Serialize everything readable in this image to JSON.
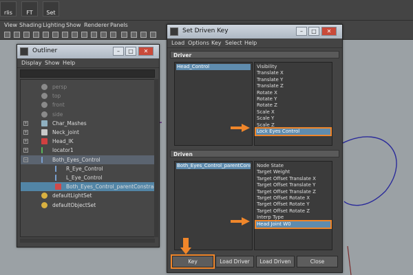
{
  "shelf": {
    "buttons": [
      {
        "label": "rlis",
        "icon": "rivet-shelf-icon"
      },
      {
        "label": "FT",
        "icon": "ft-shelf-icon"
      },
      {
        "label": "Set",
        "icon": "set-shelf-icon"
      }
    ]
  },
  "panel_menu": [
    "View",
    "Shading",
    "Lighting",
    "Show",
    "Renderer",
    "Panels"
  ],
  "outliner": {
    "title": "Outliner",
    "menus": [
      "Display",
      "Show",
      "Help"
    ],
    "items": [
      {
        "label": "persp",
        "icon": "camera-icon",
        "dim": true
      },
      {
        "label": "top",
        "icon": "camera-icon",
        "dim": true
      },
      {
        "label": "front",
        "icon": "camera-icon",
        "dim": true
      },
      {
        "label": "side",
        "icon": "camera-icon",
        "dim": true
      },
      {
        "label": "Char_Mashes",
        "icon": "mesh-icon",
        "expand": true
      },
      {
        "label": "Neck_joint",
        "icon": "joint-icon",
        "expand": true
      },
      {
        "label": "Head_IK",
        "icon": "ik-handle-icon",
        "expand": true
      },
      {
        "label": "locator1",
        "icon": "locator-icon",
        "expand": true
      },
      {
        "label": "Both_Eyes_Control",
        "icon": "curve-icon",
        "expand": true,
        "expanded": true,
        "highlight": true
      },
      {
        "label": "R_Eye_Control",
        "icon": "curve-icon",
        "child": true
      },
      {
        "label": "L_Eye_Control",
        "icon": "curve-icon",
        "child": true
      },
      {
        "label": "Both_Eyes_Control_parentConstraint1",
        "icon": "constraint-icon",
        "child": true,
        "selected": true
      },
      {
        "label": "defaultLightSet",
        "icon": "set-icon"
      },
      {
        "label": "defaultObjectSet",
        "icon": "set-icon"
      }
    ]
  },
  "sdk": {
    "title": "Set Driven Key",
    "menus": [
      "Load",
      "Options",
      "Key",
      "Select",
      "Help"
    ],
    "driver_header": "Driver",
    "driver_object": "Head_Control",
    "driver_attrs": [
      "Visibility",
      "Translate X",
      "Translate Y",
      "Translate Z",
      "Rotate X",
      "Rotate Y",
      "Rotate Z",
      "Scale X",
      "Scale Y",
      "Scale Z",
      "Lock Eyes Control"
    ],
    "driver_selected_index": 10,
    "driven_header": "Driven",
    "driven_object": "Both_Eyes_Control_parentConstrain",
    "driven_attrs": [
      "Node State",
      "Target Weight",
      "Target Offset Translate X",
      "Target Offset Translate Y",
      "Target Offset Translate Z",
      "Target Offset Rotate X",
      "Target Offset Rotate Y",
      "Target Offset Rotate Z",
      "Interp Type",
      "Head Joint W0"
    ],
    "driven_selected_index": 9,
    "buttons": [
      "Key",
      "Load Driver",
      "Load Driven",
      "Close"
    ]
  },
  "colors": {
    "highlight": "#f0862a",
    "selection": "#5f8cae"
  }
}
